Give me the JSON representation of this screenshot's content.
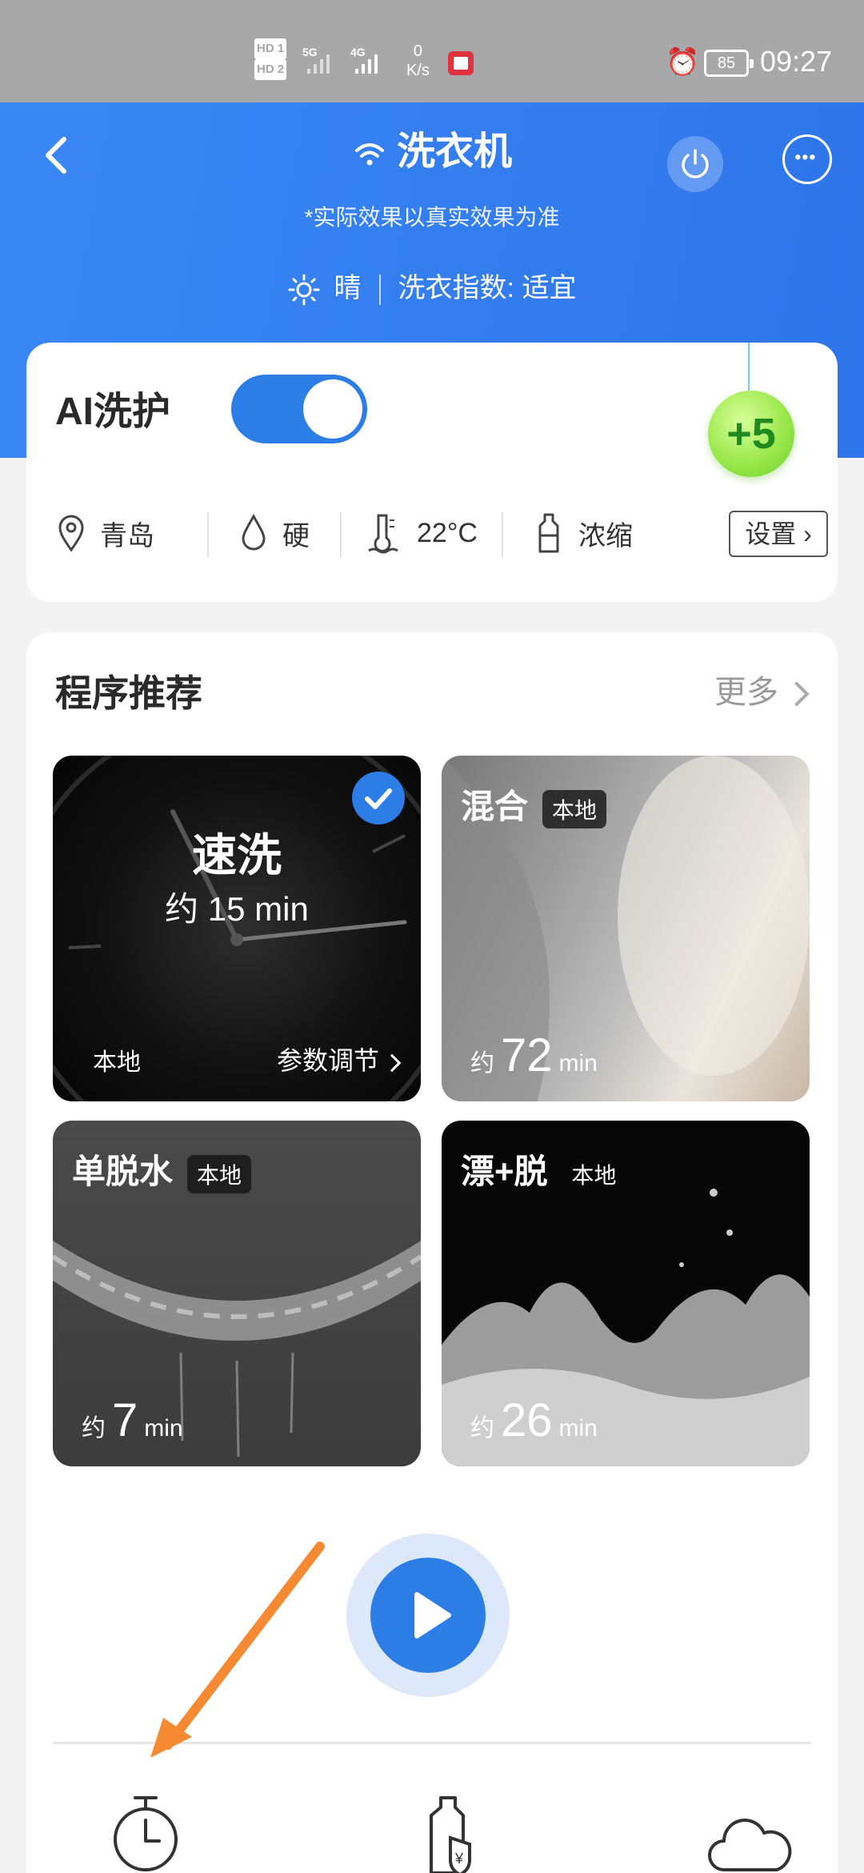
{
  "status_bar": {
    "hd1": "HD 1",
    "hd2": "HD 2",
    "net1": "5G",
    "net2": "4G",
    "speed_value": "0",
    "speed_unit": "K/s",
    "battery": "85",
    "time": "09:27"
  },
  "header": {
    "title": "洗衣机",
    "subtitle": "*实际效果以真实效果为准",
    "weather": "晴",
    "wash_index": "洗衣指数: 适宜"
  },
  "ai_card": {
    "title": "AI洗护",
    "toggle_on": true,
    "bubble": "+5",
    "location": "青岛",
    "water": "硬",
    "temperature": "22°C",
    "detergent": "浓缩",
    "settings_label": "设置"
  },
  "programs": {
    "title": "程序推荐",
    "more_label": "更多",
    "items": [
      {
        "name": "速洗",
        "time": "约 15 min",
        "source": "本地",
        "params": "参数调节",
        "selected": true
      },
      {
        "name": "混合",
        "badge": "本地",
        "prefix": "约",
        "minutes": "72",
        "unit": "min"
      },
      {
        "name": "单脱水",
        "badge": "本地",
        "prefix": "约",
        "minutes": "7",
        "unit": "min"
      },
      {
        "name": "漂+脱",
        "badge": "本地",
        "prefix": "约",
        "minutes": "26",
        "unit": "min"
      }
    ]
  },
  "colors": {
    "primary": "#2d7de6",
    "header_start": "#3a88f5",
    "arrow": "#f68a33"
  },
  "icons": [
    "back-icon",
    "wifi-icon",
    "power-icon",
    "more-icon",
    "sun-icon",
    "location-icon",
    "water-drop-icon",
    "thermometer-icon",
    "detergent-bottle-icon",
    "check-icon",
    "play-icon",
    "timer-icon",
    "detergent-price-icon",
    "cloud-icon"
  ]
}
